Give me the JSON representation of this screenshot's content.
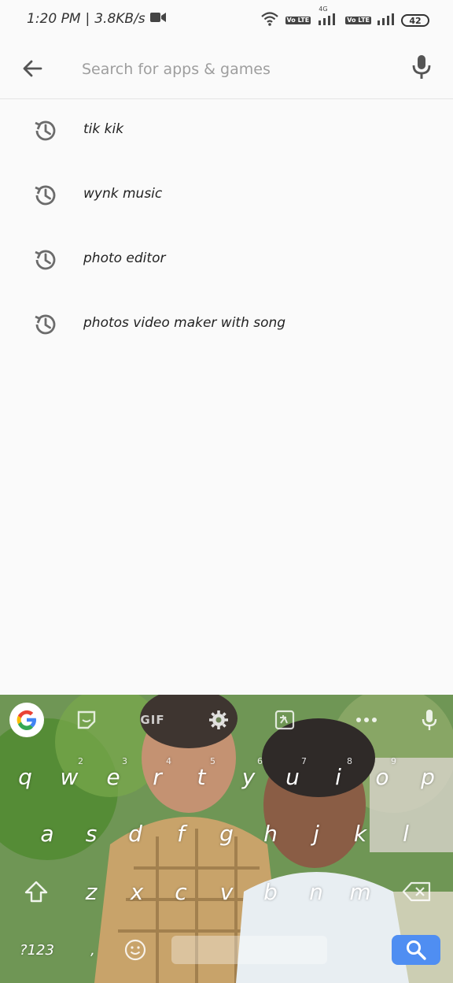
{
  "status_bar": {
    "time": "1:20 PM",
    "separator": "|",
    "speed": "3.8KB/s",
    "network_label": "4G",
    "volte_label": "Vo LTE",
    "battery": "42"
  },
  "search": {
    "placeholder": "Search for apps & games",
    "value": ""
  },
  "history": [
    {
      "label": "tik kik"
    },
    {
      "label": "wynk music"
    },
    {
      "label": "photo editor"
    },
    {
      "label": "photos video maker with song"
    }
  ],
  "keyboard": {
    "toolbar": {
      "gif_label": "GIF"
    },
    "row1": [
      {
        "key": "q",
        "hint": ""
      },
      {
        "key": "w",
        "hint": "2"
      },
      {
        "key": "e",
        "hint": "3"
      },
      {
        "key": "r",
        "hint": "4"
      },
      {
        "key": "t",
        "hint": "5"
      },
      {
        "key": "y",
        "hint": "6"
      },
      {
        "key": "u",
        "hint": "7"
      },
      {
        "key": "i",
        "hint": "8"
      },
      {
        "key": "o",
        "hint": "9"
      },
      {
        "key": "p",
        "hint": ""
      }
    ],
    "row2": [
      "a",
      "s",
      "d",
      "f",
      "g",
      "h",
      "j",
      "k",
      "l"
    ],
    "row3": [
      "z",
      "x",
      "c",
      "v",
      "b",
      "n",
      "m"
    ],
    "symbols_label": "?123",
    "comma_label": ","
  },
  "colors": {
    "accent_search_key": "#4f8ef2",
    "icon_gray": "#6b6b6b"
  }
}
